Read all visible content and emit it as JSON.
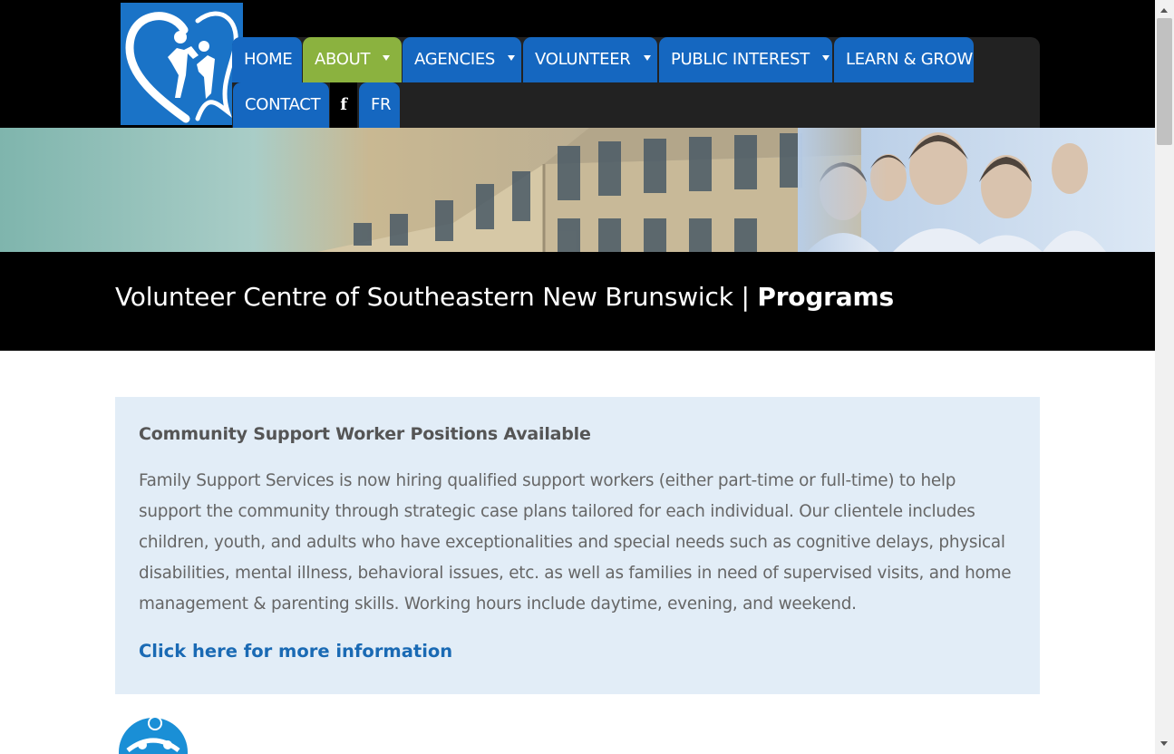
{
  "nav": {
    "items": [
      {
        "label": "HOME",
        "has_dropdown": false,
        "active": false
      },
      {
        "label": "ABOUT",
        "has_dropdown": true,
        "active": true
      },
      {
        "label": "AGENCIES",
        "has_dropdown": true,
        "active": false
      },
      {
        "label": "VOLUNTEER",
        "has_dropdown": true,
        "active": false
      },
      {
        "label": "PUBLIC INTEREST",
        "has_dropdown": true,
        "active": false
      },
      {
        "label": "LEARN & GROW",
        "has_dropdown": false,
        "active": false
      },
      {
        "label": "CONTACT",
        "has_dropdown": false,
        "active": false
      }
    ],
    "facebook_label": "f",
    "language_label": "FR",
    "colors": {
      "nav_blue": "#1567c0",
      "active_green": "#8bb23f"
    }
  },
  "header": {
    "site_name": "Volunteer Centre of Southeastern New Brunswick",
    "separator": "|",
    "page_name": "Programs"
  },
  "notice": {
    "heading": "Community Support Worker Positions Available",
    "body": "Family Support Services is now hiring qualified support workers (either part-time or full-time) to help support the community through strategic case plans tailored for each individual.  Our clientele includes children, youth, and adults who have exceptionalities and special needs such as cognitive delays, physical disabilities, mental illness, behavioral issues, etc. as well as families in need of supervised visits, and home management & parenting skills.  Working hours include daytime, evening, and weekend.",
    "link_text": "Click here for more information"
  },
  "icons": {
    "logo": "volunteer-centre-logo",
    "caret": "caret-down-icon",
    "partner_logo": "family-support-logo"
  }
}
